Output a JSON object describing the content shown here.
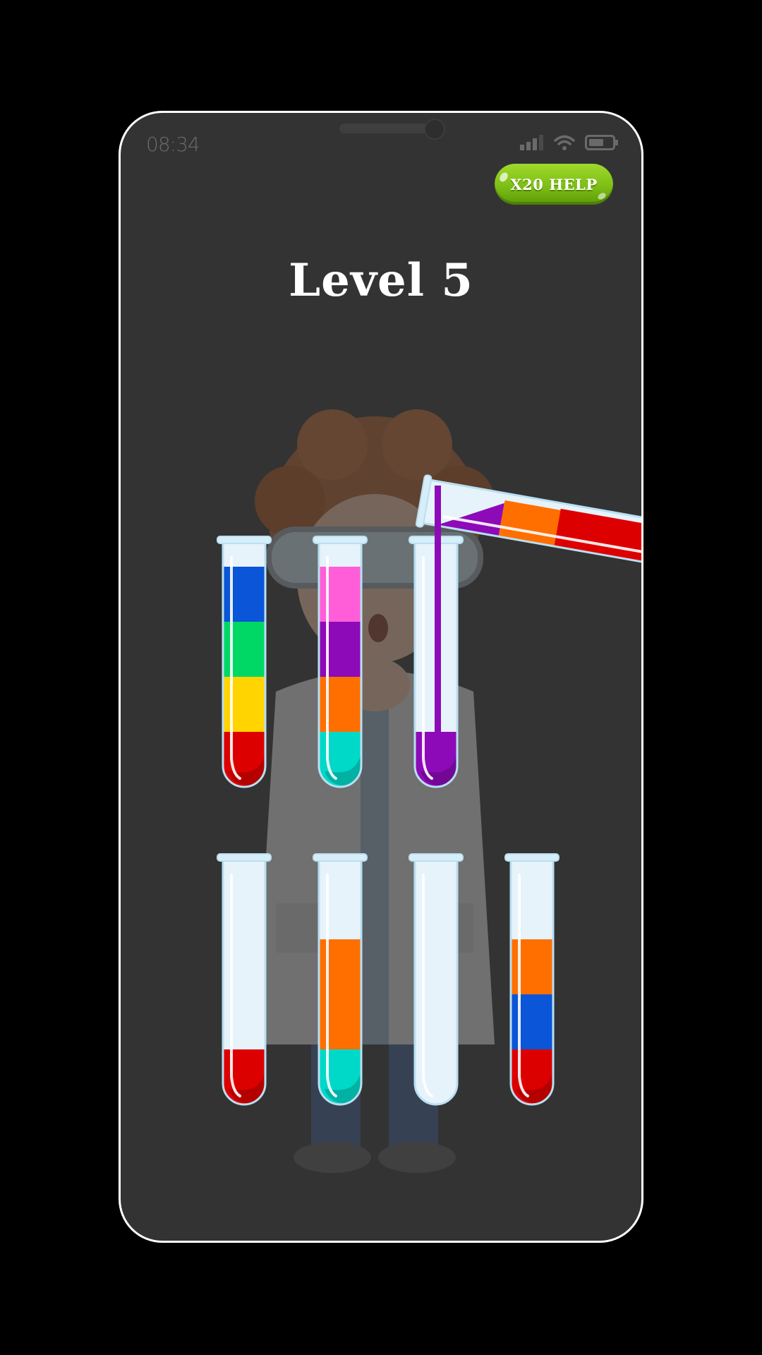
{
  "status_bar": {
    "time": "08:34",
    "icons": [
      "signal-icon",
      "wifi-icon",
      "battery-icon"
    ]
  },
  "help_button": {
    "label": "X20 HELP"
  },
  "level": {
    "title": "Level 5"
  },
  "background_character": "scientist-icon",
  "colors": {
    "blue": "#0a55d8",
    "green": "#00d866",
    "yellow": "#ffd400",
    "red": "#dd0000",
    "pink": "#ff5ed8",
    "purple": "#8d0ab8",
    "orange": "#ff6f00",
    "teal": "#00d8c8",
    "glass": "#e6f3fb",
    "glass_rim": "#b9dff2"
  },
  "tubes": [
    {
      "row": 1,
      "layers_top_to_bottom": [
        "blue",
        "green",
        "yellow",
        "red"
      ]
    },
    {
      "row": 1,
      "layers_top_to_bottom": [
        "pink",
        "purple",
        "orange",
        "teal"
      ]
    },
    {
      "row": 1,
      "layers_top_to_bottom": [
        "purple"
      ]
    },
    {
      "row": 2,
      "layers_top_to_bottom": [
        "red"
      ]
    },
    {
      "row": 2,
      "layers_top_to_bottom": [
        "orange",
        "orange",
        "teal"
      ]
    },
    {
      "row": 2,
      "layers_top_to_bottom": []
    },
    {
      "row": 2,
      "layers_top_to_bottom": [
        "orange",
        "blue",
        "red"
      ]
    }
  ],
  "pouring_tube": {
    "layers_from_mouth": [
      "purple",
      "orange",
      "red"
    ],
    "stream_color": "purple",
    "target_tube_index": 2
  },
  "tube_capacity": 4
}
